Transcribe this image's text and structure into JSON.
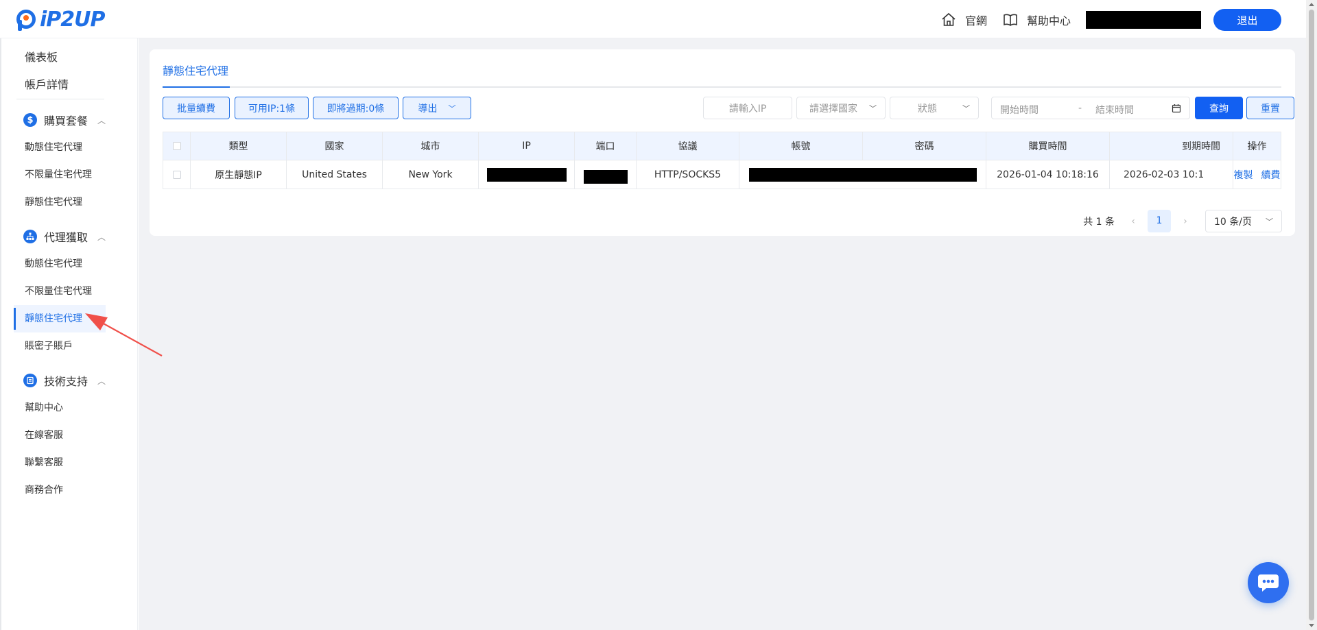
{
  "header": {
    "logo_text": "iP2UP",
    "links": [
      {
        "label": "官網",
        "icon": "home-icon"
      },
      {
        "label": "幫助中心",
        "icon": "book-icon"
      }
    ],
    "logout_label": "退出"
  },
  "sidebar": {
    "top_items": [
      {
        "label": "儀表板"
      },
      {
        "label": "帳戶詳情"
      }
    ],
    "groups": [
      {
        "label": "購買套餐",
        "icon": "dollar-icon",
        "items": [
          {
            "label": "動態住宅代理"
          },
          {
            "label": "不限量住宅代理"
          },
          {
            "label": "靜態住宅代理"
          }
        ]
      },
      {
        "label": "代理獲取",
        "icon": "network-icon",
        "items": [
          {
            "label": "動態住宅代理"
          },
          {
            "label": "不限量住宅代理"
          },
          {
            "label": "靜態住宅代理",
            "active": true
          },
          {
            "label": "賬密子賬戶"
          }
        ]
      },
      {
        "label": "技術支持",
        "icon": "support-icon",
        "items": [
          {
            "label": "幫助中心"
          },
          {
            "label": "在線客服"
          },
          {
            "label": "聯繫客服"
          },
          {
            "label": "商務合作"
          }
        ]
      }
    ]
  },
  "main": {
    "tab_label": "靜態住宅代理",
    "toolbar": {
      "batch_renew": "批量續費",
      "available_ip": "可用IP:1條",
      "expiring": "即將過期:0條",
      "export": "導出",
      "ip_placeholder": "請輸入IP",
      "country_placeholder": "請選擇國家",
      "status_placeholder": "狀態",
      "start_placeholder": "開始時間",
      "range_sep": "-",
      "end_placeholder": "結束時間",
      "query": "查詢",
      "reset": "重置"
    },
    "table": {
      "columns": [
        "類型",
        "國家",
        "城市",
        "IP",
        "端口",
        "協議",
        "帳號",
        "密碼",
        "購買時間",
        "到期時間",
        "操作"
      ],
      "rows": [
        {
          "type": "原生靜態IP",
          "country": "United States",
          "city": "New York",
          "protocol": "HTTP/SOCKS5",
          "purchase_time": "2026-01-04 10:18:16",
          "expire_time": "2026-02-03 10:1",
          "op_copy": "複製",
          "op_renew": "續費"
        }
      ]
    },
    "pagination": {
      "total": "共 1 条",
      "prev": "‹",
      "current_page": "1",
      "next": "›",
      "page_size": "10 条/页"
    }
  },
  "colors": {
    "accent": "#1f6fe5",
    "primary_button": "#1260f2",
    "background": "#f1f2f5",
    "annotation_arrow": "#f0504a"
  }
}
